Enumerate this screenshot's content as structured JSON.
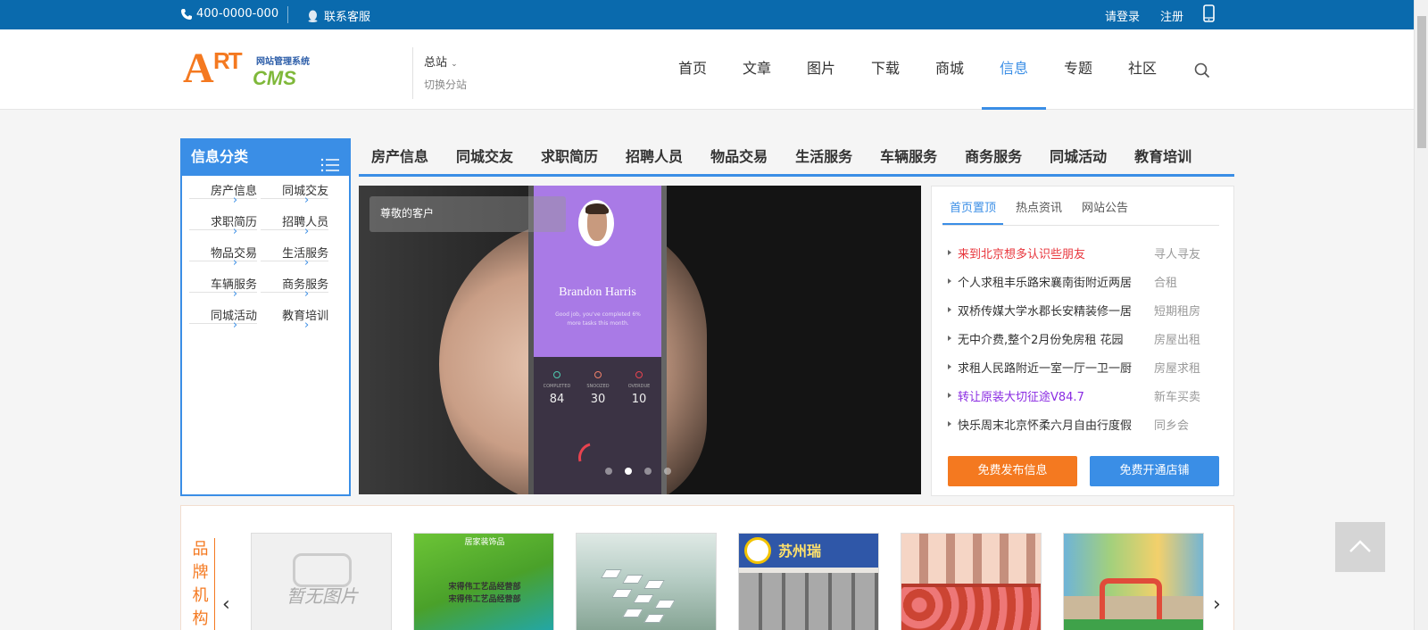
{
  "topbar": {
    "phone": "400-0000-000",
    "service": "联系客服",
    "login": "请登录",
    "register": "注册"
  },
  "header": {
    "logo": {
      "letter_a": "A",
      "letters_rt": "RT",
      "cms": "CMS",
      "tagline": "网站管理系统"
    },
    "site_switch": {
      "name": "总站",
      "hint": "切换分站"
    },
    "nav": [
      "首页",
      "文章",
      "图片",
      "下载",
      "商城",
      "信息",
      "专题",
      "社区"
    ],
    "nav_active": "信息"
  },
  "category_box": {
    "title": "信息分类",
    "items": [
      "房产信息",
      "同城交友",
      "求职简历",
      "招聘人员",
      "物品交易",
      "生活服务",
      "车辆服务",
      "商务服务",
      "同城活动",
      "教育培训"
    ]
  },
  "category_tabs": [
    "房产信息",
    "同城交友",
    "求职简历",
    "招聘人员",
    "物品交易",
    "生活服务",
    "车辆服务",
    "商务服务",
    "同城活动",
    "教育培训"
  ],
  "slider": {
    "caption": "尊敬的客户",
    "phone_screen": {
      "name": "Brandon Harris",
      "message": "Good job, you've completed 6% more tasks this month.",
      "stats": [
        {
          "label": "COMPLETED",
          "value": "84",
          "color": "#4ecbb0"
        },
        {
          "label": "SNOOZED",
          "value": "30",
          "color": "#f0816a"
        },
        {
          "label": "OVERDUE",
          "value": "10",
          "color": "#e8434f"
        }
      ]
    },
    "dots": 4,
    "active_dot": 1
  },
  "news": {
    "tabs": [
      "首页置顶",
      "热点资讯",
      "网站公告"
    ],
    "active_tab": 0,
    "items": [
      {
        "title": "来到北京想多认识些朋友",
        "tag": "寻人寻友",
        "color": "#e8343b"
      },
      {
        "title": "个人求租丰乐路宋襄南街附近两居",
        "tag": "合租",
        "color": "#333333"
      },
      {
        "title": "双桥传媒大学水郡长安精装修一居",
        "tag": "短期租房",
        "color": "#333333"
      },
      {
        "title": "无中介费,整个2月份免房租 花园",
        "tag": "房屋出租",
        "color": "#333333"
      },
      {
        "title": "求租人民路附近一室一厅一卫一厨",
        "tag": "房屋求租",
        "color": "#333333"
      },
      {
        "title": "转让原装大切征途V84.7",
        "tag": "新车买卖",
        "color": "#8a2be2"
      },
      {
        "title": "快乐周末北京怀柔六月自由行度假",
        "tag": "同乡会",
        "color": "#333333"
      }
    ],
    "btn_publish": "免费发布信息",
    "btn_shop": "免费开通店铺"
  },
  "brand": {
    "title": "品牌机构",
    "noimg_text": "暂无图片",
    "item2_top": "居家装饰品",
    "item2_line1": "宋得伟工艺品经营部",
    "item2_line2": "宋得伟工艺品经营部",
    "item4_sign": "苏州瑞"
  },
  "colors": {
    "topbar": "#0a6aad",
    "accent_blue": "#3a8ee6",
    "accent_orange": "#f47920"
  }
}
